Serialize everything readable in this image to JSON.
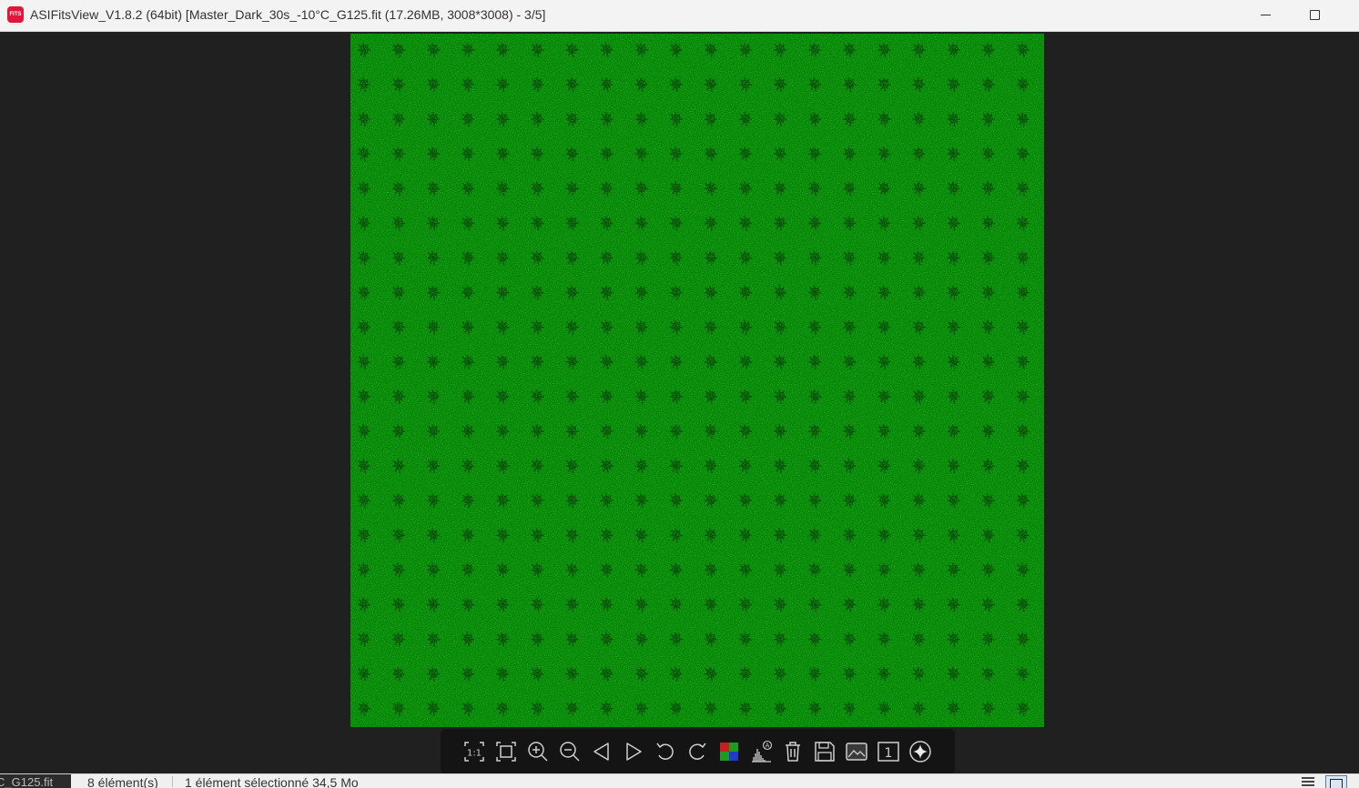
{
  "window": {
    "app_icon_text": "FITS",
    "title": "ASIFitsView_V1.8.2 (64bit) [Master_Dark_30s_-10°C_G125.fit (17.26MB, 3008*3008) - 3/5]",
    "minimize_icon": "minimize-icon",
    "maximize_icon": "maximize-icon"
  },
  "image": {
    "description_icon": "fits-image",
    "colors": {
      "base": "#0a8a0a",
      "dark": "#045d04",
      "bright": "#1fbf1f"
    }
  },
  "toolbar": {
    "buttons": [
      {
        "name": "actual-size-button",
        "icon": "one-to-one-icon",
        "text": "1:1"
      },
      {
        "name": "fit-window-button",
        "icon": "fit-window-icon"
      },
      {
        "name": "zoom-in-button",
        "icon": "zoom-in-icon"
      },
      {
        "name": "zoom-out-button",
        "icon": "zoom-out-icon"
      },
      {
        "name": "previous-button",
        "icon": "triangle-left-icon"
      },
      {
        "name": "next-button",
        "icon": "triangle-right-icon"
      },
      {
        "name": "rotate-left-button",
        "icon": "rotate-left-icon"
      },
      {
        "name": "rotate-right-button",
        "icon": "rotate-right-icon"
      },
      {
        "name": "debayer-button",
        "icon": "bayer-color-icon"
      },
      {
        "name": "auto-stretch-button",
        "icon": "histogram-auto-icon",
        "text": "A"
      },
      {
        "name": "delete-button",
        "icon": "trash-icon"
      },
      {
        "name": "save-button",
        "icon": "floppy-disk-icon"
      },
      {
        "name": "image-info-button",
        "icon": "image-icon"
      },
      {
        "name": "single-frame-button",
        "icon": "one-frame-icon",
        "text": "1"
      },
      {
        "name": "star-detect-button",
        "icon": "sparkle-icon"
      }
    ]
  },
  "status_bar": {
    "tab_fragment": "C_G125.fit",
    "item_count": "8 élément(s)",
    "selection": "1 élément sélectionné  34,5 Mo",
    "list_view_icon": "list-view-icon",
    "tiles_view_icon": "tiles-view-icon"
  }
}
